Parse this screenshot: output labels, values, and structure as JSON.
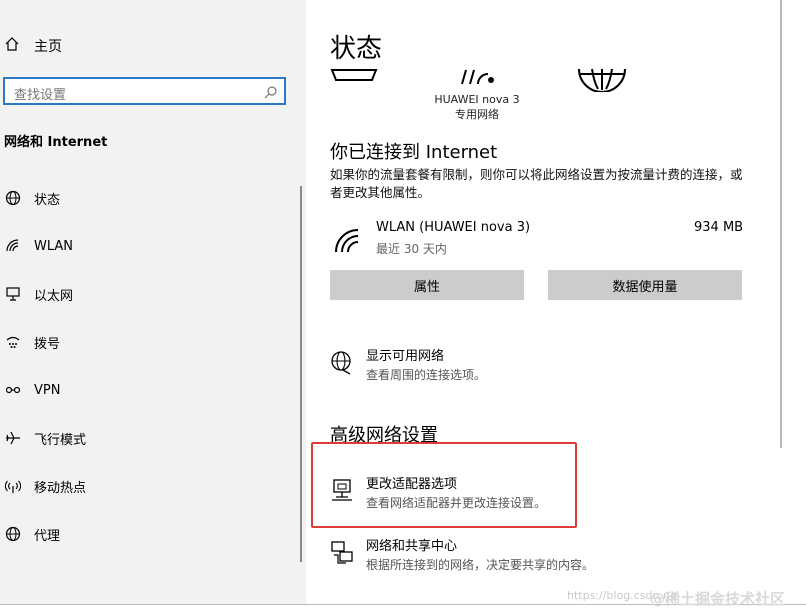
{
  "sidebar": {
    "home_label": "主页",
    "search_placeholder": "查找设置",
    "section_title": "网络和 Internet",
    "items": [
      {
        "label": "状态",
        "icon": "globe-status-icon"
      },
      {
        "label": "WLAN",
        "icon": "wifi-icon"
      },
      {
        "label": "以太网",
        "icon": "ethernet-icon"
      },
      {
        "label": "拨号",
        "icon": "dialup-icon"
      },
      {
        "label": "VPN",
        "icon": "vpn-icon"
      },
      {
        "label": "飞行模式",
        "icon": "airplane-icon"
      },
      {
        "label": "移动热点",
        "icon": "hotspot-icon"
      },
      {
        "label": "代理",
        "icon": "globe-proxy-icon"
      }
    ]
  },
  "main": {
    "title": "状态",
    "network_diagram": {
      "caption_line1": "HUAWEI nova 3",
      "caption_line2": "专用网络"
    },
    "connected_heading": "你已连接到 Internet",
    "connected_desc": "如果你的流量套餐有限制，则你可以将此网络设置为按流量计费的连接，或者更改其他属性。",
    "connection": {
      "name": "WLAN (HUAWEI nova 3)",
      "period": "最近 30 天内",
      "usage": "934 MB"
    },
    "buttons": {
      "properties": "属性",
      "data_usage": "数据使用量"
    },
    "show_networks": {
      "title": "显示可用网络",
      "desc": "查看周围的连接选项。"
    },
    "advanced_heading": "高级网络设置",
    "adapter_options": {
      "title": "更改适配器选项",
      "desc": "查看网络适配器并更改连接设置。"
    },
    "sharing_center": {
      "title": "网络和共享中心",
      "desc": "根据所连接到的网络，决定要共享的内容。"
    }
  },
  "watermark": {
    "url_text": "https://blog.csdn.ne",
    "brand_text": "@稀土掘金技术社区"
  },
  "colors": {
    "accent": "#2b79c9",
    "highlight": "#e03b3b",
    "button_bg": "#cccccc",
    "sidebar_bg": "#f2f2f2"
  }
}
